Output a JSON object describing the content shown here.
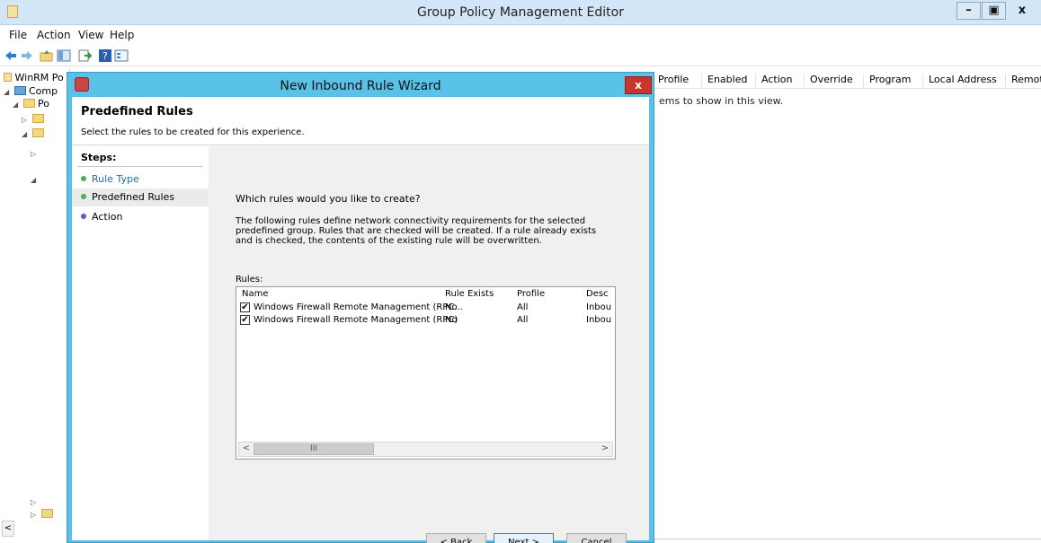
{
  "window": {
    "title": "Group Policy Management Editor"
  },
  "menu": [
    "File",
    "Action",
    "View",
    "Help"
  ],
  "toolbar": {
    "icons": [
      "back-arrow-icon",
      "forward-arrow-icon",
      "up-folder-icon",
      "show-hide-tree-icon",
      "export-list-icon",
      "help-icon",
      "properties-icon"
    ]
  },
  "tree": {
    "root": "WinRM Po",
    "comp": "Comp",
    "po": "Po"
  },
  "list": {
    "columns": [
      "Profile",
      "Enabled",
      "Action",
      "Override",
      "Program",
      "Local Address",
      "Remot"
    ],
    "empty": "ems to show in this view."
  },
  "dialog": {
    "title": "New Inbound Rule Wizard",
    "close": "x",
    "heading": "Predefined Rules",
    "subheading": "Select the rules to be created for this experience.",
    "steps_title": "Steps:",
    "steps": [
      {
        "label": "Rule Type"
      },
      {
        "label": "Predefined Rules"
      },
      {
        "label": "Action"
      }
    ],
    "question": "Which rules would you like to create?",
    "description": "The following rules define network connectivity requirements for the selected predefined group. Rules that are checked will be created. If a rule already exists and is checked, the contents of the existing rule will be overwritten.",
    "rules_label": "Rules:",
    "columns": [
      "Name",
      "Rule Exists",
      "Profile",
      "Desc"
    ],
    "rows": [
      {
        "checked": true,
        "name": "Windows Firewall Remote Management (RPC...",
        "exists": "No",
        "profile": "All",
        "desc": "Inbou"
      },
      {
        "checked": true,
        "name": "Windows Firewall Remote Management (RPC)",
        "exists": "No",
        "profile": "All",
        "desc": "Inbou"
      }
    ],
    "back": "< Back",
    "next": "Next >",
    "cancel": "Cancel"
  },
  "colors": {
    "dialog_frame": "#5bc2e7",
    "close": "#c7352b",
    "step_active": "#1a6fb0",
    "dot_done": "#4caf50",
    "dot_todo": "#5a5ac8"
  }
}
